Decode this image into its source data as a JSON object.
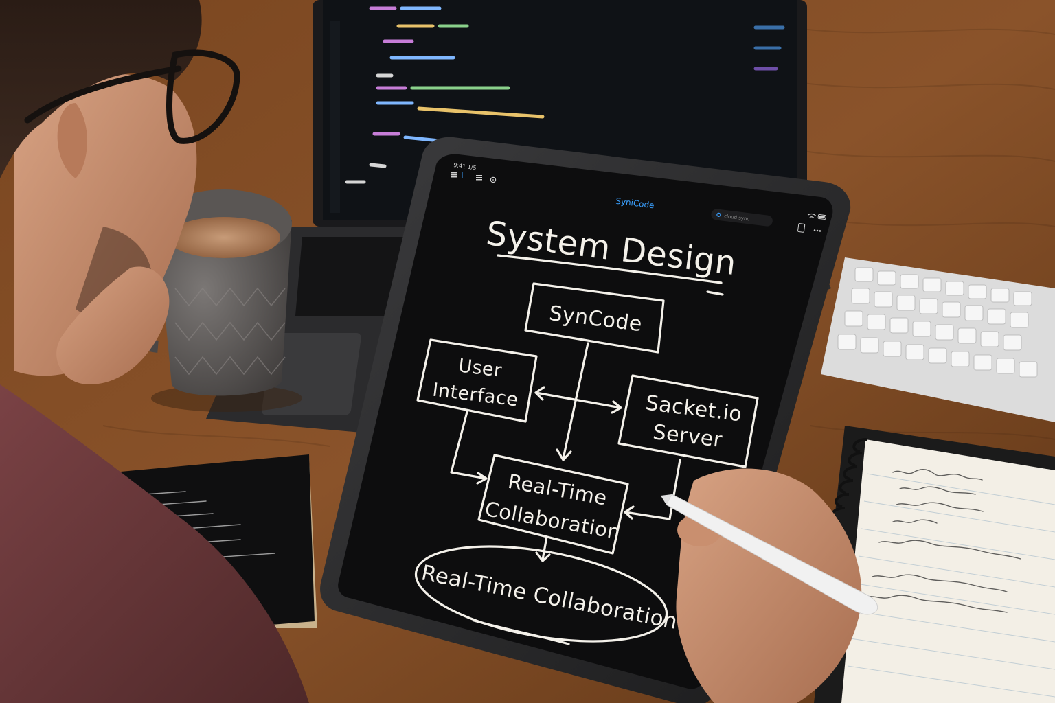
{
  "tablet": {
    "status_time": "9:41 1/5",
    "app_name": "SyniCode",
    "status_pill": "cloud sync",
    "toolbar_icons": [
      "menu-icon",
      "list-icon",
      "clock-icon"
    ],
    "status_icons": [
      "wifi-icon",
      "battery-icon"
    ]
  },
  "diagram": {
    "title": "System Design",
    "nodes": {
      "top": "SynCode",
      "left_line1": "User",
      "left_line2": "Interface",
      "right_line1": "Sacket.io",
      "right_line2": "Server",
      "center_line1": "Real-Time",
      "center_line2": "Collaboration",
      "ellipse": "Real-Time Collaboration"
    }
  },
  "colors": {
    "accent": "#3aa0ff",
    "chalk": "#f4f1ea",
    "tablet_screen": "#0d0d0e",
    "desk": "#6b3d1c",
    "shirt": "#6d3a3c"
  }
}
